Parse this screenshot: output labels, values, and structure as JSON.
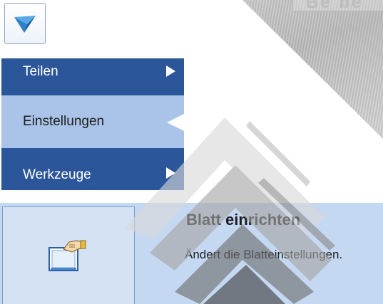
{
  "window": {
    "app_icon": "app-logo-icon",
    "banner_text": "Be be"
  },
  "menu": {
    "items": [
      {
        "label": "Teilen",
        "state": "normal",
        "has_submenu": true
      },
      {
        "label": "Einstellungen",
        "state": "selected",
        "has_submenu": false
      },
      {
        "label": "Werkzeuge",
        "state": "normal",
        "has_submenu": true
      }
    ]
  },
  "command": {
    "icon": "page-setup-hand-icon",
    "title": "Blatt einrichten",
    "description": "Ändert die Blatteinstellungen."
  },
  "colors": {
    "menu_dark": "#2b579a",
    "menu_selected": "#a9c4e8",
    "panel": "#c5d8f1"
  }
}
